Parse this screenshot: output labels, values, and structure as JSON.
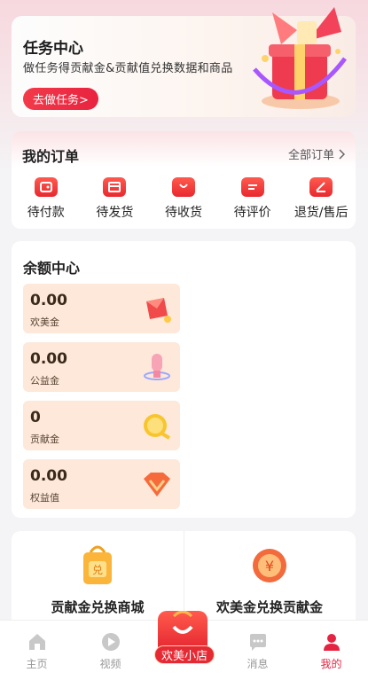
{
  "task_center": {
    "title": "任务中心",
    "subtitle": "做任务得贡献金&贡献值兑换数据和商品",
    "button_label": "去做任务>"
  },
  "orders": {
    "title": "我的订单",
    "all_label": "全部订单",
    "items": [
      {
        "label": "待付款",
        "icon": "wallet-icon"
      },
      {
        "label": "待发货",
        "icon": "calendar-icon"
      },
      {
        "label": "待收货",
        "icon": "shopping-bag-icon"
      },
      {
        "label": "待评价",
        "icon": "comment-icon"
      },
      {
        "label": "退货/售后",
        "icon": "return-icon"
      }
    ]
  },
  "balance": {
    "title": "余额中心",
    "items": [
      {
        "value": "0.00",
        "name": "欢美金",
        "icon": "red-envelope-icon"
      },
      {
        "value": "0.00",
        "name": "公益金",
        "icon": "trophy-icon"
      },
      {
        "value": "0",
        "name": "贡献金",
        "icon": "gold-coin-icon"
      },
      {
        "value": "0.00",
        "name": "权益值",
        "icon": "diamond-icon"
      }
    ]
  },
  "exchange": {
    "left_label": "贡献金兑换商城",
    "right_label": "欢美金兑换贡献金"
  },
  "tabbar": {
    "items": [
      {
        "label": "主页",
        "icon": "home-icon"
      },
      {
        "label": "视频",
        "icon": "video-icon"
      },
      {
        "label": "欢美小店",
        "icon": "shop-bag-icon"
      },
      {
        "label": "消息",
        "icon": "message-icon"
      },
      {
        "label": "我的",
        "icon": "profile-icon"
      }
    ],
    "active_color": "#e42441"
  }
}
